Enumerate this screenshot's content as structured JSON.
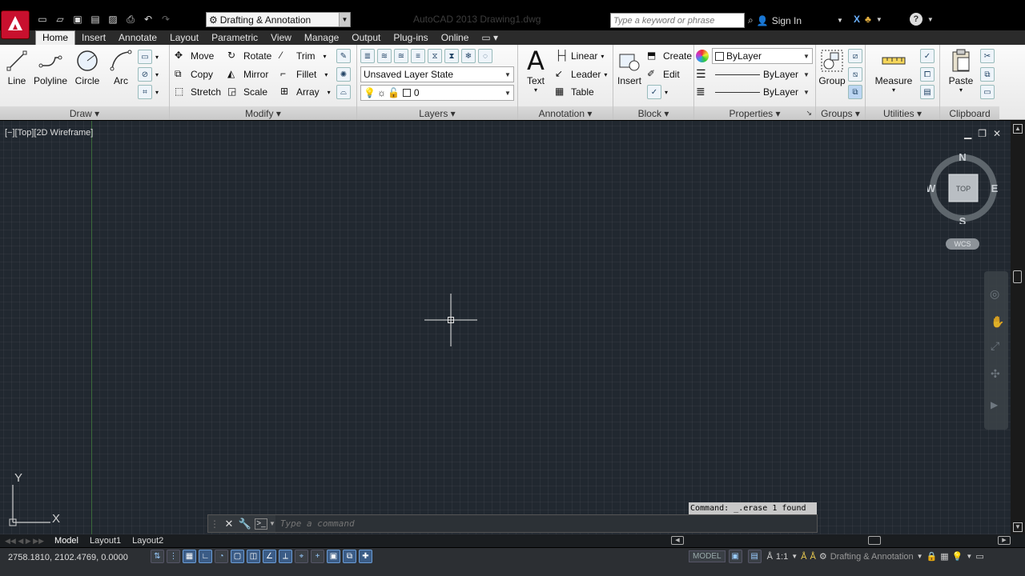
{
  "title": {
    "workspace": "Drafting & Annotation",
    "window_title": "AutoCAD 2013   Drawing1.dwg",
    "search_placeholder": "Type a keyword or phrase",
    "sign_in": "Sign In"
  },
  "tabs": [
    "Home",
    "Insert",
    "Annotate",
    "Layout",
    "Parametric",
    "View",
    "Manage",
    "Output",
    "Plug-ins",
    "Online"
  ],
  "ribbon": {
    "draw": {
      "label": "Draw",
      "line": "Line",
      "polyline": "Polyline",
      "circle": "Circle",
      "arc": "Arc"
    },
    "modify": {
      "label": "Modify",
      "move": "Move",
      "rotate": "Rotate",
      "trim": "Trim",
      "copy": "Copy",
      "mirror": "Mirror",
      "fillet": "Fillet",
      "stretch": "Stretch",
      "scale": "Scale",
      "array": "Array"
    },
    "layers": {
      "label": "Layers",
      "layer_state": "Unsaved Layer State",
      "current_layer": "0"
    },
    "annotation": {
      "label": "Annotation",
      "text": "Text",
      "linear": "Linear",
      "leader": "Leader",
      "table": "Table"
    },
    "block": {
      "label": "Block",
      "insert": "Insert",
      "create": "Create",
      "edit": "Edit"
    },
    "properties": {
      "label": "Properties",
      "color": "ByLayer",
      "linetype": "ByLayer",
      "lineweight": "ByLayer"
    },
    "groups": {
      "label": "Groups",
      "group": "Group"
    },
    "utilities": {
      "label": "Utilities",
      "measure": "Measure"
    },
    "clipboard": {
      "label": "Clipboard",
      "paste": "Paste"
    }
  },
  "viewport": {
    "controls": "[−][Top][2D Wireframe]",
    "viewcube": {
      "north": "N",
      "south": "S",
      "east": "E",
      "west": "W",
      "face": "TOP"
    },
    "wcs": "WCS",
    "ucs_x": "X",
    "ucs_y": "Y"
  },
  "command": {
    "history": "Command: _.erase 1 found",
    "placeholder": "Type a command"
  },
  "layout_tabs": [
    "Model",
    "Layout1",
    "Layout2"
  ],
  "status": {
    "coordinates": "2758.1810, 2102.4769, 0.0000",
    "model": "MODEL",
    "scale": "1:1",
    "workspace": "Drafting & Annotation"
  },
  "colors": {
    "canvas_bg": "#212830",
    "ribbon_bg": "#f0f0f0",
    "title_bg": "#000000",
    "accent_red": "#c8102e"
  }
}
